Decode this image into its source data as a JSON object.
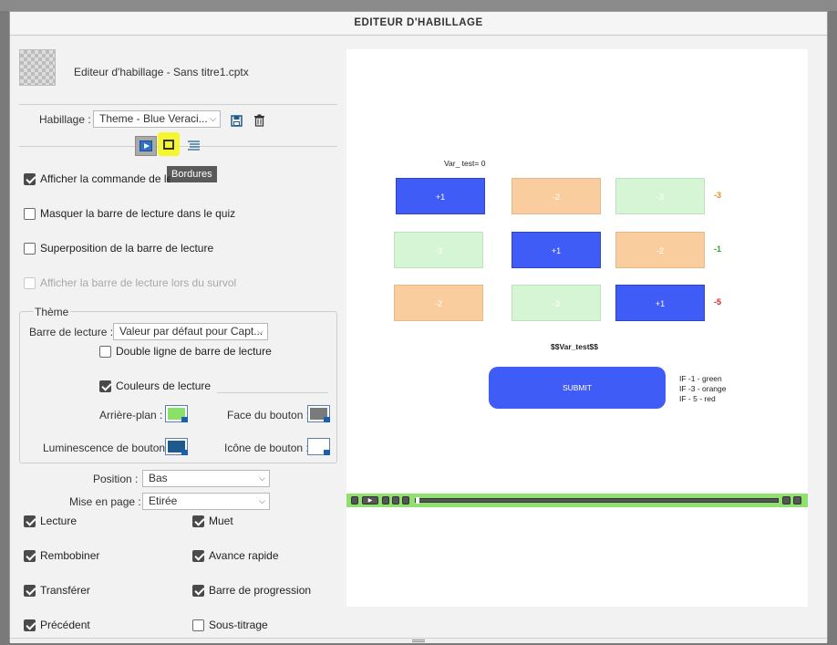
{
  "window": {
    "title": "EDITEUR D'HABILLAGE"
  },
  "header": {
    "file_label": "Editeur d'habillage - Sans titre1.cptx"
  },
  "skin": {
    "label": "Habillage :",
    "selected": "Theme - Blue Veraci...",
    "save_icon": "save-icon",
    "delete_icon": "trash-icon"
  },
  "tabs": [
    {
      "name": "playback-control-tab",
      "icon": "play-icon",
      "active": true
    },
    {
      "name": "borders-tab",
      "icon": "square-icon",
      "active": false,
      "highlighted": true
    },
    {
      "name": "toc-tab",
      "icon": "list-icon",
      "active": false
    }
  ],
  "tooltip": "Bordures",
  "options": [
    {
      "label": "Afficher la commande de lecture",
      "checked": true,
      "disabled": false
    },
    {
      "label": "Masquer la barre de lecture dans le quiz",
      "checked": false,
      "disabled": false
    },
    {
      "label": "Superposition de la barre de lecture",
      "checked": false,
      "disabled": false
    },
    {
      "label": "Afficher la barre de lecture lors du survol",
      "checked": false,
      "disabled": true
    }
  ],
  "theme": {
    "legend": "Thème",
    "playbar_label": "Barre de lecture :",
    "playbar_value": "Valeur par défaut pour Capt...",
    "double_line": {
      "label": "Double ligne de barre de lecture",
      "checked": false
    },
    "colors": {
      "label": "Couleurs de lecture",
      "checked": true
    },
    "background_label": "Arrière-plan :",
    "button_face_label": "Face du bouton :",
    "glow_label": "Luminescence de bouton :",
    "button_icon_label": "Icône de bouton :",
    "background_color": "#8be06a",
    "button_face_color": "#7a7a7a",
    "glow_color": "#1e5a8e",
    "button_icon_color": "#ffffff"
  },
  "layout_opts": {
    "position_label": "Position :",
    "position_value": "Bas",
    "layout_label": "Mise en page :",
    "layout_value": "Etirée"
  },
  "controls": [
    {
      "label": "Lecture",
      "checked": true
    },
    {
      "label": "Muet",
      "checked": true
    },
    {
      "label": "Rembobiner",
      "checked": true
    },
    {
      "label": "Avance rapide",
      "checked": true
    },
    {
      "label": "Transférer",
      "checked": true
    },
    {
      "label": "Barre de progression",
      "checked": true
    },
    {
      "label": "Précédent",
      "checked": true
    },
    {
      "label": "Sous-titrage",
      "checked": false
    }
  ],
  "preview": {
    "var_label": "Var_ test= 0",
    "grid": [
      [
        {
          "text": "+1",
          "color": "blue"
        },
        {
          "text": "-2",
          "color": "orange"
        },
        {
          "text": "-3",
          "color": "green"
        }
      ],
      [
        {
          "text": "-3",
          "color": "green"
        },
        {
          "text": "+1",
          "color": "blue"
        },
        {
          "text": "-2",
          "color": "orange"
        }
      ],
      [
        {
          "text": "-2",
          "color": "orange"
        },
        {
          "text": "-3",
          "color": "green"
        },
        {
          "text": "+1",
          "color": "blue"
        }
      ]
    ],
    "row_scores": [
      {
        "text": "-3",
        "color": "#f08a1c"
      },
      {
        "text": "-1",
        "color": "#2aa52a"
      },
      {
        "text": "-5",
        "color": "#e02020"
      }
    ],
    "var_display": "$$Var_test$$",
    "submit": "SUBMIT",
    "rules": [
      "IF -1 - green",
      "IF -3 - orange",
      "IF - 5 - red"
    ]
  }
}
